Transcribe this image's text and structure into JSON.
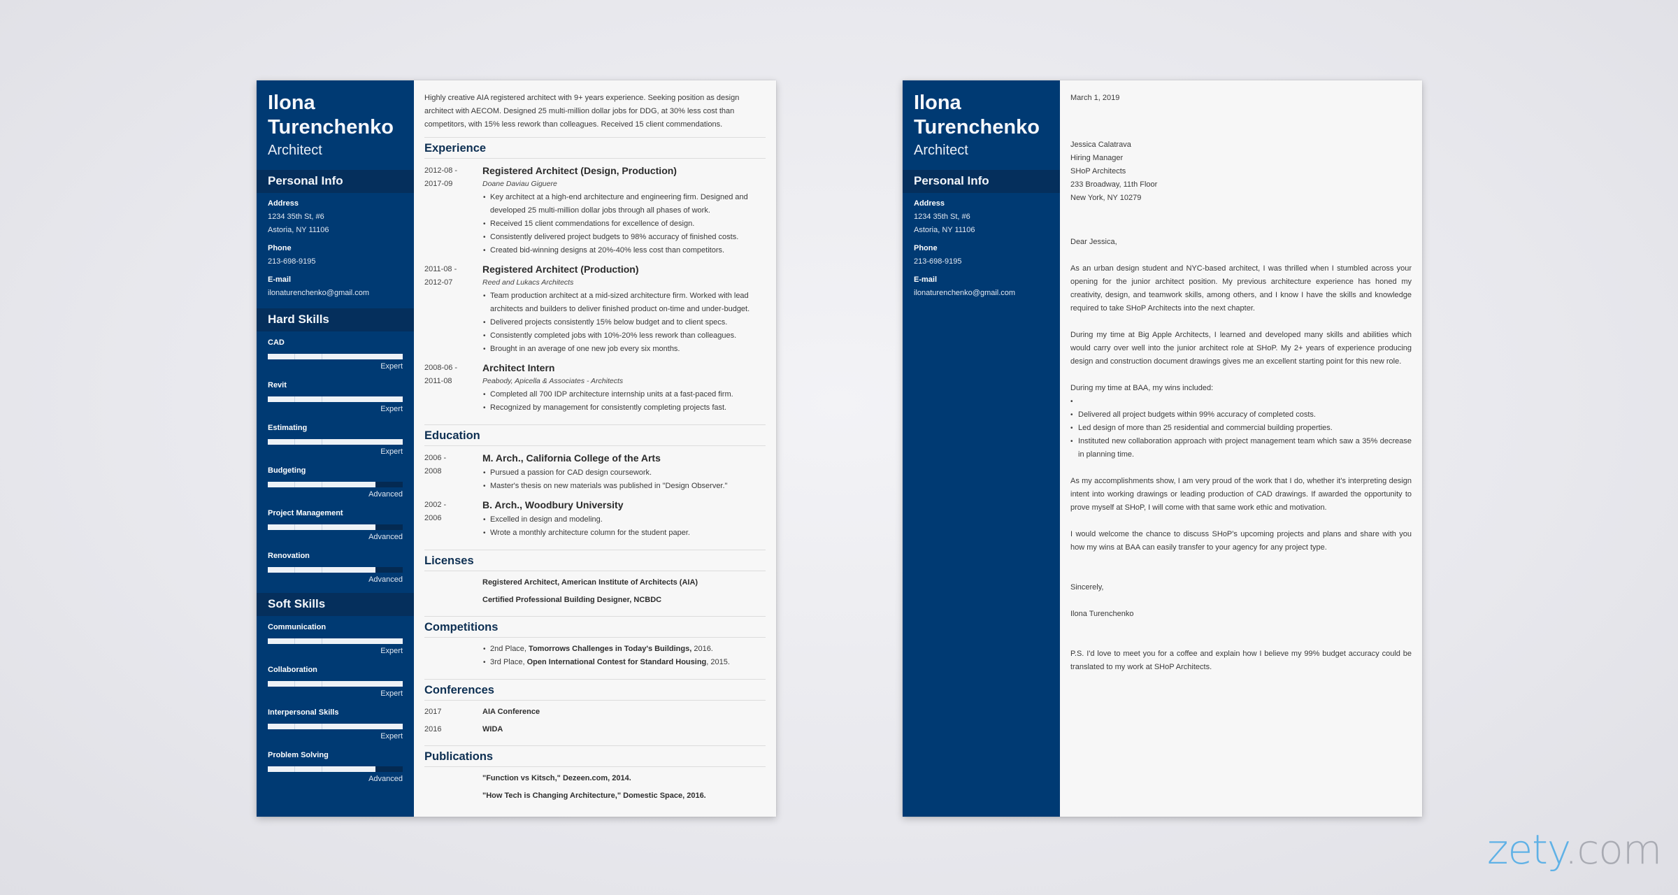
{
  "resume": {
    "name_line1": "Ilona",
    "name_line2": "Turenchenko",
    "title": "Architect",
    "personal_info": {
      "heading": "Personal Info",
      "address_label": "Address",
      "address_line1": "1234 35th St, #6",
      "address_line2": "Astoria, NY 11106",
      "phone_label": "Phone",
      "phone": "213-698-9195",
      "email_label": "E-mail",
      "email": "ilonaturenchenko@gmail.com"
    },
    "hard_skills": {
      "heading": "Hard Skills",
      "items": [
        {
          "name": "CAD",
          "level": "Expert",
          "fill": 1.0
        },
        {
          "name": "Revit",
          "level": "Expert",
          "fill": 1.0
        },
        {
          "name": "Estimating",
          "level": "Expert",
          "fill": 1.0
        },
        {
          "name": "Budgeting",
          "level": "Advanced",
          "fill": 0.8
        },
        {
          "name": "Project Management",
          "level": "Advanced",
          "fill": 0.8
        },
        {
          "name": "Renovation",
          "level": "Advanced",
          "fill": 0.8
        }
      ]
    },
    "soft_skills": {
      "heading": "Soft Skills",
      "items": [
        {
          "name": "Communication",
          "level": "Expert",
          "fill": 1.0
        },
        {
          "name": "Collaboration",
          "level": "Expert",
          "fill": 1.0
        },
        {
          "name": "Interpersonal Skills",
          "level": "Expert",
          "fill": 1.0
        },
        {
          "name": "Problem Solving",
          "level": "Advanced",
          "fill": 0.8
        }
      ]
    },
    "summary": "Highly creative AIA registered architect with 9+ years experience. Seeking position as design architect with AECOM. Designed 25 multi-million dollar jobs for DDG, at 30% less cost than competitors, with 15% less rework than colleagues. Received 15 client commendations.",
    "experience": {
      "heading": "Experience",
      "items": [
        {
          "dates": "2012-08 -\n2017-09",
          "title": "Registered Architect (Design, Production)",
          "company": "Doane Daviau Giguere",
          "bullets": [
            "Key architect at a high-end architecture and engineering firm. Designed and developed 25 multi-million dollar jobs through all phases of work.",
            "Received 15 client commendations for excellence of design.",
            "Consistently delivered project budgets to 98% accuracy of finished costs.",
            "Created bid-winning designs at 20%-40% less cost than competitors."
          ]
        },
        {
          "dates": "2011-08 -\n2012-07",
          "title": "Registered Architect (Production)",
          "company": "Reed and Lukacs Architects",
          "bullets": [
            "Team production architect at a mid-sized architecture firm. Worked with lead architects and builders to deliver finished product on-time and under-budget.",
            "Delivered projects consistently 15% below budget and to client specs.",
            "Consistently completed jobs with 10%-20% less rework than colleagues.",
            "Brought in an average of one new job every six months."
          ]
        },
        {
          "dates": "2008-06 -\n2011-08",
          "title": "Architect Intern",
          "company": "Peabody, Apicella & Associates - Architects",
          "bullets": [
            "Completed all 700 IDP architecture internship units at a fast-paced firm.",
            "Recognized by management for consistently completing projects fast."
          ]
        }
      ]
    },
    "education": {
      "heading": "Education",
      "items": [
        {
          "dates": "2006 -\n2008",
          "title": "M. Arch., California College of the Arts",
          "bullets": [
            "Pursued a passion for CAD design coursework.",
            "Master's thesis on new materials was published in \"Design Observer.\""
          ]
        },
        {
          "dates": "2002 -\n2006",
          "title": "B. Arch., Woodbury University",
          "bullets": [
            "Excelled in design and modeling.",
            "Wrote a monthly architecture column for the student paper."
          ]
        }
      ]
    },
    "licenses": {
      "heading": "Licenses",
      "items": [
        "Registered Architect, American Institute of Architects (AIA)",
        "Certified Professional Building Designer, NCBDC"
      ]
    },
    "competitions": {
      "heading": "Competitions",
      "items": [
        {
          "place": "2nd Place, ",
          "name": "Tomorrows Challenges in Today's Buildings,",
          "year": " 2016."
        },
        {
          "place": "3rd Place, ",
          "name": "Open International Contest for Standard Housing",
          "year": ", 2015."
        }
      ]
    },
    "conferences": {
      "heading": "Conferences",
      "items": [
        {
          "year": "2017",
          "name": "AIA Conference"
        },
        {
          "year": "2016",
          "name": "WIDA"
        }
      ]
    },
    "publications": {
      "heading": "Publications",
      "items": [
        "\"Function vs Kitsch,\" Dezeen.com, 2014.",
        "\"How Tech is Changing Architecture,\" Domestic Space, 2016."
      ]
    }
  },
  "letter": {
    "date": "March 1, 2019",
    "recipient": [
      "Jessica Calatrava",
      "Hiring Manager",
      "SHoP Architects",
      "233 Broadway, 11th Floor",
      "New York, NY 10279"
    ],
    "greeting": "Dear Jessica,",
    "paragraph1": "As an urban design student and NYC-based architect, I was thrilled when I stumbled across your opening for the junior architect position. My previous architecture experience has honed my creativity, design, and teamwork skills, among others, and I know I have the skills and knowledge required to take SHoP Architects into the next chapter.",
    "paragraph2": "During my time at Big Apple Architects, I learned and developed many skills and abilities which would carry over well into the junior architect role at SHoP. My 2+ years of experience producing design and construction document drawings gives me an excellent starting point for this new role.",
    "wins_intro": "During my time at BAA, my wins included:",
    "wins": [
      "",
      "Delivered all project budgets within 99% accuracy of completed costs.",
      "Led design of more than 25 residential and commercial building properties.",
      "Instituted new collaboration approach with project management team which saw a 35% decrease in planning time."
    ],
    "paragraph3": "As my accomplishments show, I am very proud of the work that I do, whether it's interpreting design intent into working drawings or leading production of CAD drawings. If awarded the opportunity to prove myself at SHoP, I will come with that same work ethic and motivation.",
    "paragraph4": "I would welcome the chance to discuss SHoP's upcoming projects and plans and share with you how my wins at BAA can easily transfer to your agency for any project type.",
    "closing": "Sincerely,",
    "signature": "Ilona Turenchenko",
    "ps": "P.S. I'd love to meet you for a coffee and explain how I believe my 99% budget accuracy could be translated to my work at SHoP Architects."
  },
  "brand": {
    "part1": "zety",
    "part2": ".com",
    "colors": {
      "primary": "#5fb1e6",
      "secondary": "#a9abb3",
      "sidebar": "#003a73"
    }
  }
}
